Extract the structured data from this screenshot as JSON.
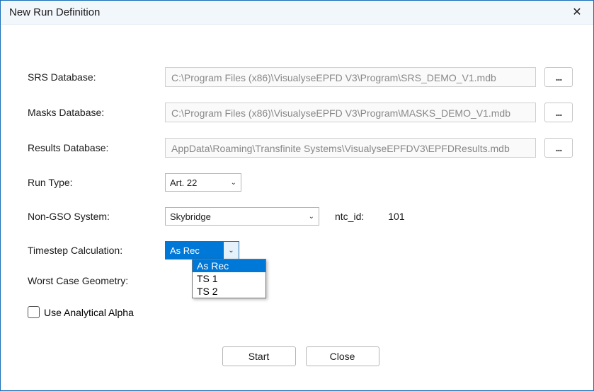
{
  "window": {
    "title": "New Run Definition"
  },
  "labels": {
    "srs": "SRS Database:",
    "masks": "Masks Database:",
    "results": "Results Database:",
    "run_type": "Run Type:",
    "non_gso": "Non-GSO System:",
    "ntc_id": "ntc_id:",
    "timestep": "Timestep Calculation:",
    "worst_case": "Worst Case Geometry:",
    "use_alpha": "Use Analytical Alpha"
  },
  "paths": {
    "srs": "C:\\Program Files (x86)\\VisualyseEPFD V3\\Program\\SRS_DEMO_V1.mdb",
    "masks": "C:\\Program Files (x86)\\VisualyseEPFD V3\\Program\\MASKS_DEMO_V1.mdb",
    "results": "AppData\\Roaming\\Transfinite Systems\\VisualyseEPFDV3\\EPFDResults.mdb"
  },
  "browse_label": "...",
  "run_type": {
    "value": "Art. 22"
  },
  "non_gso": {
    "value": "Skybridge",
    "ntc_id": "101"
  },
  "timestep": {
    "value": "As Rec",
    "options": [
      "As Rec",
      "TS 1",
      "TS 2"
    ]
  },
  "buttons": {
    "start": "Start",
    "close": "Close"
  }
}
